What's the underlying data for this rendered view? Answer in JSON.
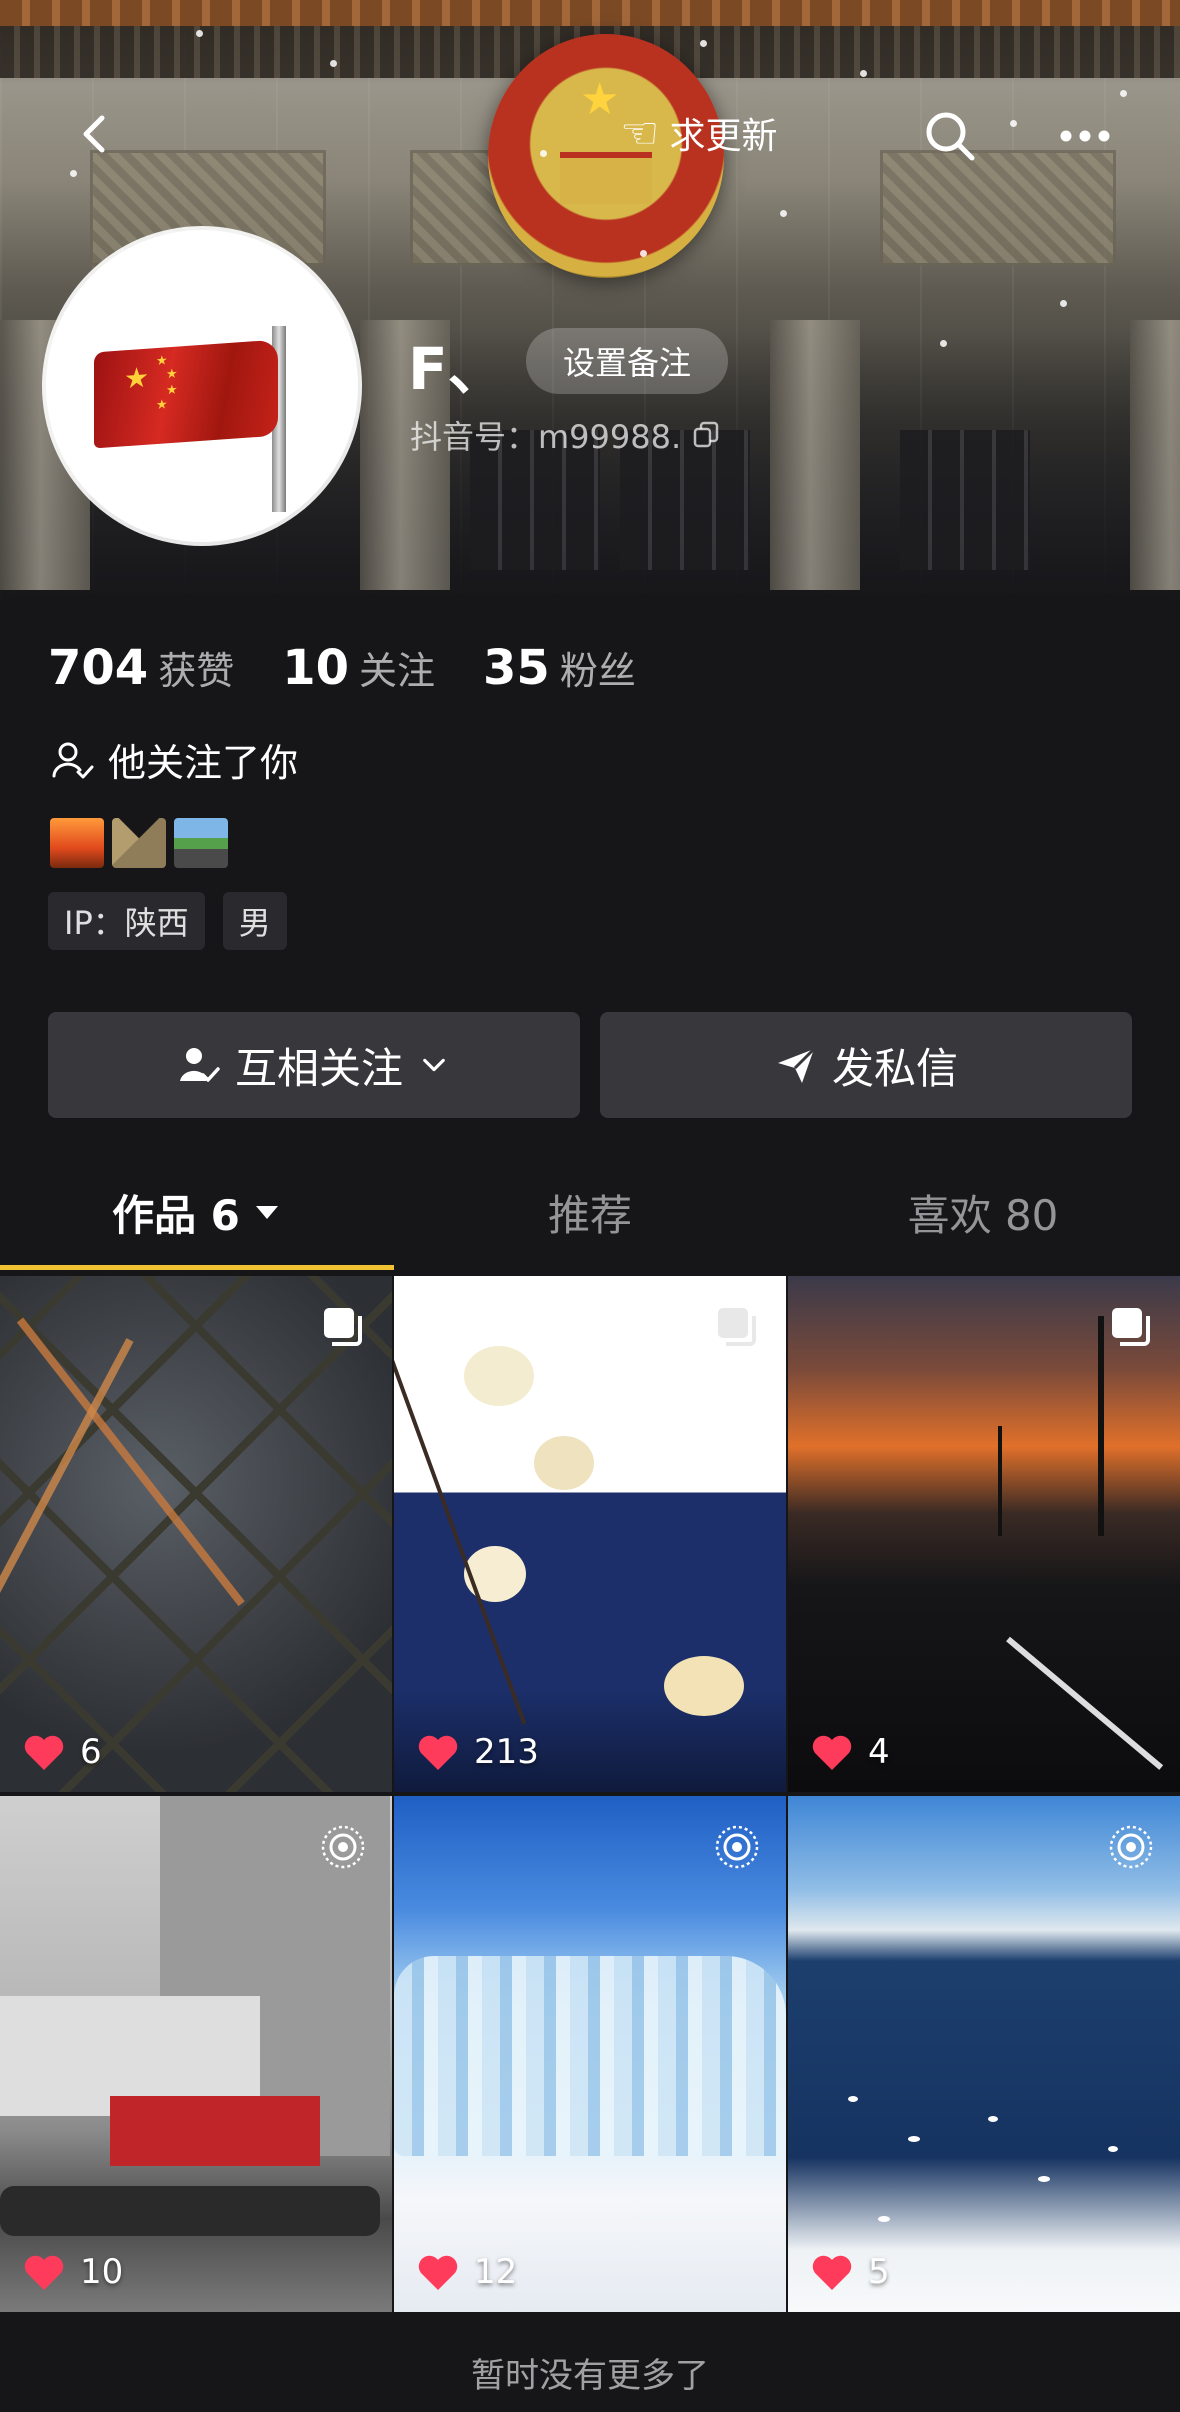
{
  "header": {
    "update_label": "求更新",
    "back_icon": "chevron-left-icon",
    "search_icon": "search-icon",
    "more_icon": "more-horizontal-icon"
  },
  "profile": {
    "name": "F、",
    "remark_button": "设置备注",
    "douyin_id": "抖音号：m99988.",
    "stats": [
      {
        "num": "704",
        "label": "获赞"
      },
      {
        "num": "10",
        "label": "关注"
      },
      {
        "num": "35",
        "label": "粉丝"
      }
    ],
    "follows_you": "他关注了你",
    "tags": [
      "IP：陕西",
      "男"
    ]
  },
  "actions": {
    "follow": "互相关注",
    "message": "发私信"
  },
  "tabs": [
    {
      "label": "作品 6",
      "active": true
    },
    {
      "label": "推荐",
      "active": false
    },
    {
      "label": "喜欢 80",
      "active": false
    }
  ],
  "posts": [
    {
      "likes": "6"
    },
    {
      "likes": "213"
    },
    {
      "likes": "4"
    },
    {
      "likes": "10"
    },
    {
      "likes": "12"
    },
    {
      "likes": "5"
    }
  ],
  "footer": {
    "note": "暂时没有更多了"
  },
  "colors": {
    "background": "#161619",
    "tab_indicator": "#f1c232",
    "like_heart": "#ff3b5c",
    "button_bg": "#38383c"
  }
}
